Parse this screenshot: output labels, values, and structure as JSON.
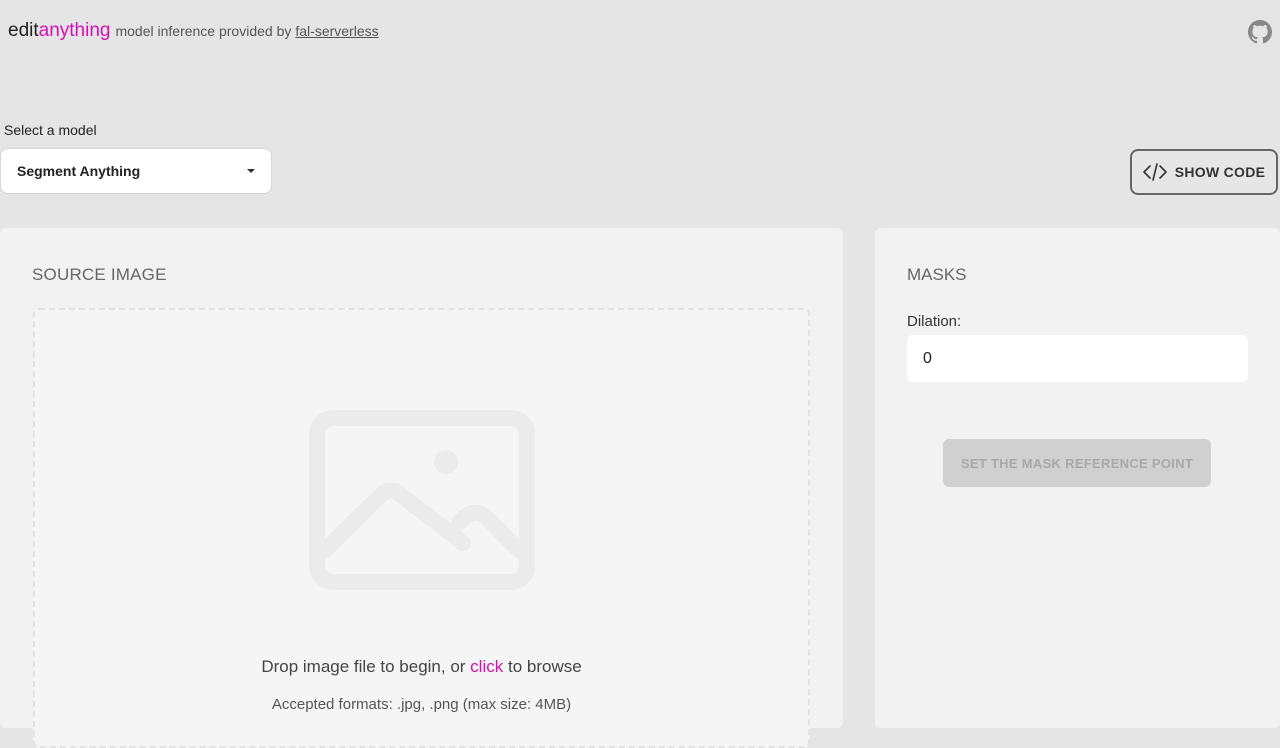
{
  "header": {
    "logo_edit": "edit",
    "logo_anything": "anything",
    "subtitle": "model inference provided by",
    "link": "fal-serverless",
    "github_icon": "github-icon"
  },
  "model_select": {
    "label": "Select a model",
    "value": "Segment Anything"
  },
  "code_button": {
    "label": "SHOW CODE",
    "icon": "code-icon"
  },
  "source": {
    "title": "SOURCE IMAGE",
    "drop_prefix": "Drop image file to begin, or",
    "drop_link": "click",
    "drop_suffix": "to browse",
    "formats": "Accepted formats: .jpg, .png (max size: 4MB)"
  },
  "masks": {
    "title": "MASKS",
    "dilation_label": "Dilation:",
    "dilation_value": "0",
    "button_label": "SET THE MASK REFERENCE POINT"
  },
  "colors": {
    "accent": "#d40fb4",
    "background": "#e5e5e5",
    "panel": "#f2f2f2"
  }
}
